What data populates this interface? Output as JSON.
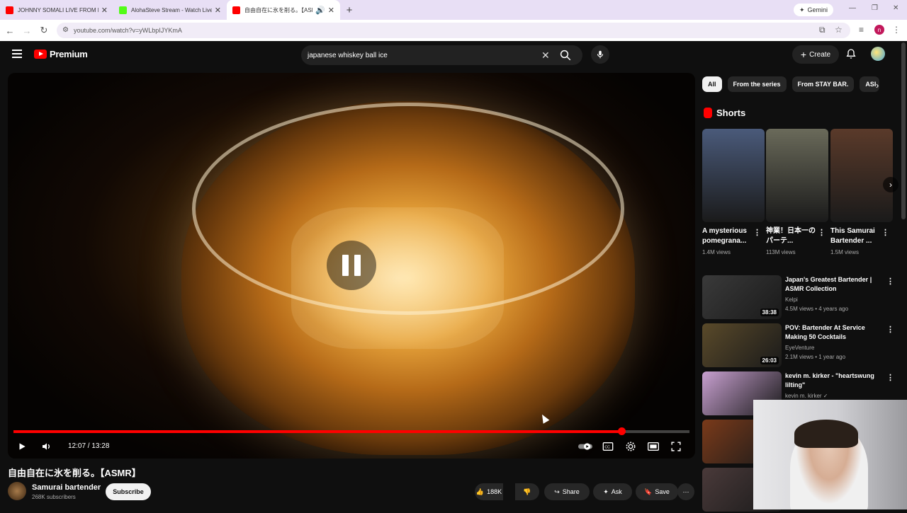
{
  "browser": {
    "tabs": [
      {
        "title": "JOHNNY SOMALI LIVE FROM K",
        "favicon_color": "#ff0000",
        "active": false
      },
      {
        "title": "AlohaSteve Stream - Watch Live",
        "favicon_color": "#53fc18",
        "active": false
      },
      {
        "title": "自由自在に氷を削る。【ASMR",
        "favicon_color": "#ff0000",
        "active": true
      }
    ],
    "new_tab_label": "+",
    "gemini_label": "Gemini",
    "url": "youtube.com/watch?v=yWLbpIJYKmA",
    "profile_initial": "n"
  },
  "youtube": {
    "logo_text": "Premium",
    "search": {
      "value": "japanese whiskey ball ice"
    },
    "create_label": "Create"
  },
  "player": {
    "current_time": "12:07",
    "separator": " / ",
    "duration": "13:28",
    "progress_fraction": 0.899,
    "buffer_fraction": 0.92
  },
  "video": {
    "title": "自由自在に氷を削る。【ASMR】",
    "channel_name": "Samurai bartender",
    "subscribers": "268K subscribers",
    "subscribe_label": "Subscribe",
    "likes": "188K",
    "share_label": "Share",
    "ask_label": "Ask",
    "save_label": "Save"
  },
  "chips": [
    "All",
    "From the series",
    "From STAY BAR.",
    "ASI"
  ],
  "shorts": {
    "heading": "Shorts",
    "items": [
      {
        "title": "A mysterious pomegrana...",
        "views": "1.4M views",
        "color": "#4a5a7a"
      },
      {
        "title": "神業！日本一のパーテ...",
        "views": "113M views",
        "color": "#6a6a5a"
      },
      {
        "title": "This Samurai Bartender ...",
        "views": "1.5M views",
        "color": "#5a3a2a"
      }
    ]
  },
  "related": [
    {
      "title": "Japan's Greatest Bartender | ASMR Collection",
      "channel": "Kelpi",
      "meta": "4.5M views • 4 years ago",
      "duration": "38:38",
      "color": "#3a3a3a"
    },
    {
      "title": "POV: Bartender At Service Making 50 Cocktails",
      "channel": "EyeVenture",
      "meta": "2.1M views • 1 year ago",
      "duration": "26:03",
      "color": "#5a4a2a"
    },
    {
      "title": "kevin m. kirker - \"heartswung lilting\"",
      "channel": "kevin m. kirker",
      "meta": "",
      "duration": "",
      "color": "#c8a0d0"
    },
    {
      "title": "",
      "channel": "",
      "meta": "",
      "duration": "",
      "color": "#7a3a1a"
    },
    {
      "title": "",
      "channel": "",
      "meta": "",
      "duration": "",
      "color": "#4a3a3a"
    }
  ]
}
